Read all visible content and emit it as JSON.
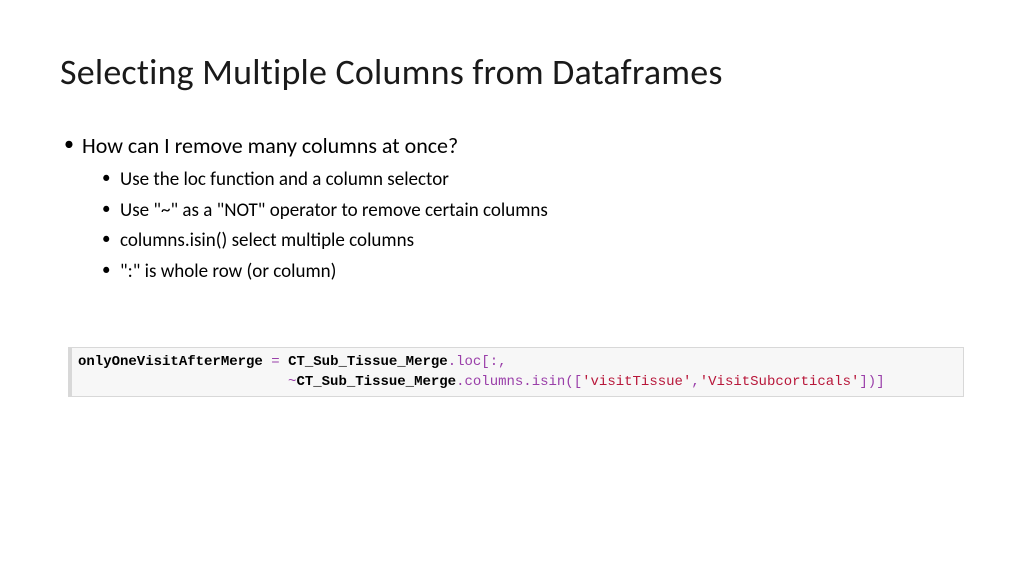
{
  "title": "Selecting Multiple Columns from Dataframes",
  "main_bullet": "How can I remove many columns at once?",
  "sub_bullets": [
    "Use the loc function and a column selector",
    "Use \"~\" as a \"NOT\" operator to remove certain columns",
    "columns.isin() select multiple columns",
    "\":\" is whole row (or column)"
  ],
  "code": {
    "var_name": "onlyOneVisitAfterMerge",
    "assign": " = ",
    "obj1": "CT_Sub_Tissue_Merge",
    "dot_loc": ".loc[:,",
    "line2_indent": "                         ",
    "tilde": "~",
    "obj2": "CT_Sub_Tissue_Merge",
    "dot_cols": ".columns.isin([",
    "str1": "'visitTissue'",
    "comma": ",",
    "str2": "'VisitSubcorticals'",
    "close": "])]"
  }
}
